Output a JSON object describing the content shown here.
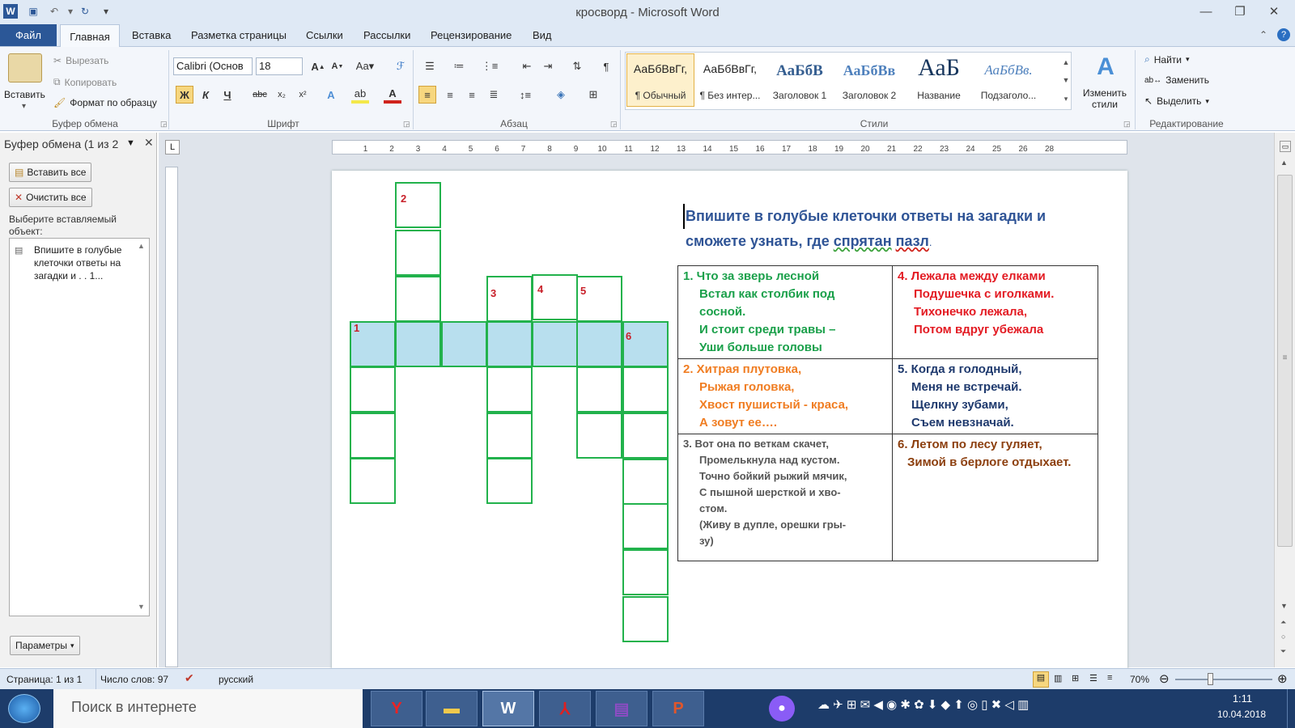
{
  "window": {
    "title": "кросворд  -  Microsoft Word"
  },
  "tabs": [
    "Файл",
    "Главная",
    "Вставка",
    "Разметка страницы",
    "Ссылки",
    "Рассылки",
    "Рецензирование",
    "Вид"
  ],
  "clipboard_group": {
    "paste": "Вставить",
    "cut": "Вырезать",
    "copy": "Копировать",
    "format": "Формат по образцу",
    "label": "Буфер обмена"
  },
  "font_group": {
    "font": "Calibri (Основ",
    "size": "18",
    "label": "Шрифт"
  },
  "paragraph_group": {
    "label": "Абзац"
  },
  "styles_group": {
    "label": "Стили",
    "styles": [
      {
        "sample": "АаБбВвГг,",
        "name": "¶ Обычный"
      },
      {
        "sample": "АаБбВвГг,",
        "name": "¶ Без интер..."
      },
      {
        "sample": "АаБбВ",
        "name": "Заголовок 1"
      },
      {
        "sample": "АаБбВв",
        "name": "Заголовок 2"
      },
      {
        "sample": "АаБ",
        "name": "Название"
      },
      {
        "sample": "АаБбВв.",
        "name": "Подзаголо..."
      }
    ],
    "change": "Изменить стили"
  },
  "editing_group": {
    "find": "Найти",
    "replace": "Заменить",
    "select": "Выделить",
    "label": "Редактирование"
  },
  "pane": {
    "title": "Буфер обмена (1 из 2",
    "paste_all": "Вставить все",
    "clear_all": "Очистить все",
    "hint": "Выберите вставляемый объект:",
    "item": "Впишите в голубые клеточки ответы на загадки и . . 1...",
    "params": "Параметры"
  },
  "document": {
    "instruction_line1": "Впишите в голубые клеточки ответы на загадки и",
    "instruction_line2_a": "сможете узнать, где ",
    "instruction_line2_b": "спрятан",
    "instruction_line2_c": " ",
    "instruction_line2_d": "пазл",
    "instruction_line2_e": ".",
    "numbers": [
      "1",
      "2",
      "3",
      "4",
      "5",
      "6"
    ],
    "riddles": {
      "r1": [
        "1.  Что за зверь лесной",
        "Встал как столбик под",
        "сосной.",
        "И стоит среди травы –",
        "Уши больше головы"
      ],
      "r2": [
        "2.  Хитрая плутовка,",
        "Рыжая головка,",
        "Хвост пушистый  - краса,",
        "А зовут ее…."
      ],
      "r3": [
        "3.   Вот она по веткам скачет,",
        "Промелькнула  над кустом.",
        "Точно бойкий рыжий мячик,",
        "С пышной шерсткой и хво-",
        "стом.",
        "(Живу в дупле, орешки гры-",
        "зу)"
      ],
      "r4": [
        "4. Лежала между елками",
        "Подушечка с иголками.",
        "Тихонечко лежала,",
        "Потом вдруг убежала"
      ],
      "r5": [
        "5. Когда я голодный,",
        "Меня не встречай.",
        "Щелкну зубами,",
        "Съем невзначай."
      ],
      "r6": [
        "6. Летом по лесу гуляет,",
        "Зимой в берлоге отдыхает."
      ]
    },
    "colors": {
      "r1": "#1aa04a",
      "r2": "#f07d22",
      "r3": "#555555",
      "r4": "#e31b23",
      "r5": "#1f3a6e",
      "r6": "#8c3f0e"
    }
  },
  "status": {
    "page": "Страница: 1 из 1",
    "words": "Число слов: 97",
    "lang": "русский",
    "zoom": "70%"
  },
  "taskbar": {
    "search": "Поиск в интернете",
    "time": "1:11",
    "date": "10.04.2018"
  },
  "ruler_labels": [
    "1",
    "2",
    "3",
    "4",
    "5",
    "6",
    "7",
    "8",
    "9",
    "10",
    "11",
    "12",
    "13",
    "14",
    "15",
    "16",
    "17",
    "18",
    "19",
    "20",
    "21",
    "22",
    "23",
    "24",
    "25",
    "26",
    "28"
  ]
}
